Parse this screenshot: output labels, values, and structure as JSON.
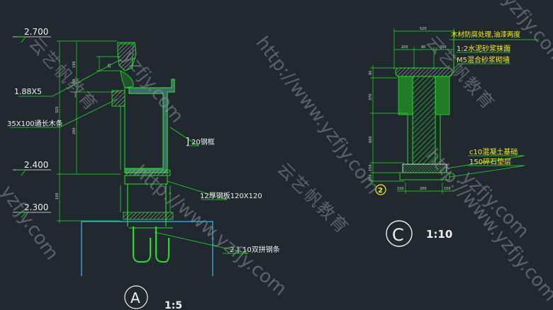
{
  "detail_a": {
    "levels": [
      "2.700",
      "2.400",
      "2.300"
    ],
    "dims": [
      "190",
      "25",
      "80",
      "320",
      "200",
      "100"
    ],
    "labels": {
      "fillet": "1.88X5",
      "timber": "35X100通长木条",
      "steel_channel": "20钢框",
      "steel_plate": "12厚钢板120X120",
      "double_channel": "10双拼钢条"
    },
    "marker": "A",
    "scale": "1:5"
  },
  "detail_c": {
    "dims_top": [
      "520",
      "200",
      "80",
      "200"
    ],
    "dims_left": [
      "80",
      "370",
      "600",
      "150",
      "150"
    ],
    "dims_bottom": [
      "150",
      "200",
      "150"
    ],
    "labels": {
      "wood_cap": "木材防腐处理,油漆两度",
      "mortar": "1:2水泥砂浆抹面",
      "brick": "M5混合砂浆砌墙",
      "concrete": "c10混凝土基础",
      "gravel": "150碎石垫层"
    },
    "sub_marker": "2",
    "marker": "C",
    "scale": "1:10"
  },
  "watermark": {
    "url": "http://www.yzfjy.com",
    "brand": "云艺帆教育",
    "fragment_a": "yzfjy.com",
    "fragment_b": "http://www.yzfjy.com",
    "fragment_c": "yzfjy.com"
  },
  "colors": {
    "background": "#212830",
    "green": "#22e022",
    "yellow": "#f4f020",
    "cyan": "#40b8e8",
    "white": "#f0f0f0"
  }
}
